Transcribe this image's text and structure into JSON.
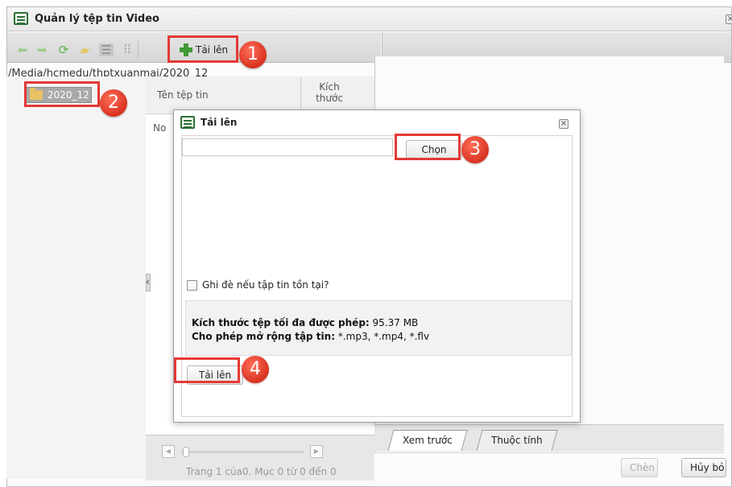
{
  "window": {
    "title": "Quản lý tệp tin Video"
  },
  "toolbar": {
    "upload_label": "Tải lên",
    "icons": [
      "back-arrow",
      "forward-arrow",
      "refresh",
      "new-folder",
      "list-view",
      "thumbnail-view",
      "add-plus"
    ]
  },
  "path": "/Media/hcmedu/thptxuanmai/2020_12",
  "tree": {
    "folder": "2020_12"
  },
  "file_list": {
    "columns": [
      "Tên tệp tin",
      "Kích thước"
    ],
    "empty_prefix": "No"
  },
  "pager": {
    "info": "Trang 1 của0. Mục 0 từ 0 đến 0"
  },
  "right_tabs": [
    "Xem trước",
    "Thuộc tính"
  ],
  "right_actions": {
    "insert": "Chèn",
    "cancel": "Hủy bỏ"
  },
  "dialog": {
    "title": "Tải lên",
    "file_value": "",
    "choose_label": "Chọn",
    "overwrite_label": "Ghi đè nếu tập tin tồn tại?",
    "max_size_label": "Kích thước tệp tối đa được phép:",
    "max_size_value": " 95.37 MB",
    "extensions_label": "Cho phép mở rộng tập tin:",
    "extensions_value": " *.mp3, *.mp4, *.flv",
    "submit_label": "Tải lên"
  },
  "annotations": {
    "step1": "1",
    "step2": "2",
    "step3": "3",
    "step4": "4"
  },
  "colors": {
    "highlight": "#e53935",
    "step_badge": "#d8321f",
    "plus_green": "#3f9a34"
  }
}
